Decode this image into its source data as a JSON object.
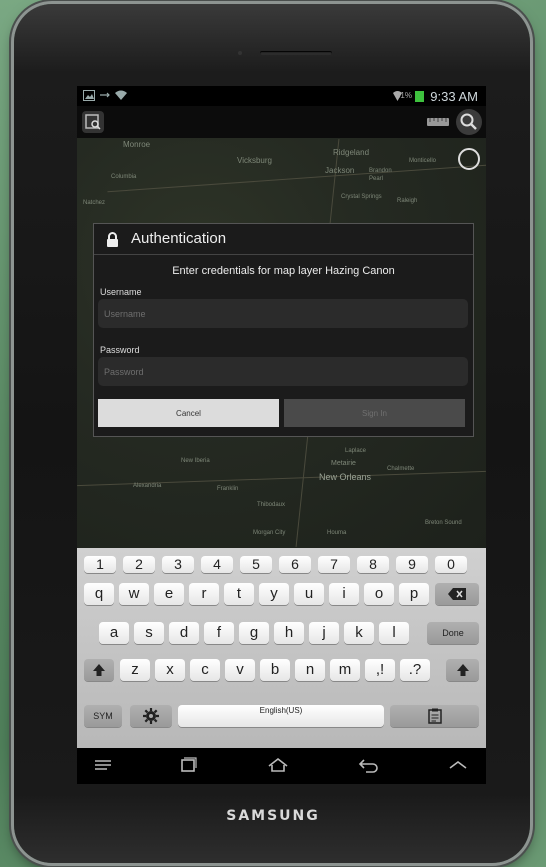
{
  "status_bar": {
    "battery_percent": "81%",
    "time": "9:33 AM"
  },
  "map": {
    "places": [
      "Monroe",
      "Vicksburg",
      "Ridgeland",
      "Jackson",
      "Pearl",
      "Columbia",
      "Brandon",
      "Crystal Springs",
      "Raleigh",
      "Natchez",
      "Monticello",
      "Alexandria",
      "New Iberia",
      "Laplace",
      "Metairie",
      "New Orleans",
      "Chalmette",
      "Houma",
      "Thibodaux",
      "Morgan City",
      "Breton Sound",
      "Franklin"
    ]
  },
  "dialog": {
    "title": "Authentication",
    "message": "Enter credentials for map layer Hazing Canon",
    "username_label": "Username",
    "username_placeholder": "Username",
    "password_label": "Password",
    "password_placeholder": "Password",
    "cancel_label": "Cancel",
    "sign_in_label": "Sign In"
  },
  "keyboard": {
    "numbers": [
      "1",
      "2",
      "3",
      "4",
      "5",
      "6",
      "7",
      "8",
      "9",
      "0"
    ],
    "row1": [
      "q",
      "w",
      "e",
      "r",
      "t",
      "y",
      "u",
      "i",
      "o",
      "p"
    ],
    "row2": [
      "a",
      "s",
      "d",
      "f",
      "g",
      "h",
      "j",
      "k",
      "l"
    ],
    "row3": [
      "z",
      "x",
      "c",
      "v",
      "b",
      "n",
      "m"
    ],
    "done": "Done",
    "sym": "SYM",
    "space_label": "English(US)",
    "comma": ",!",
    "period": ".?"
  },
  "device": {
    "brand": "SAMSUNG"
  },
  "colors": {
    "battery": "#3ec13e",
    "background": "#5e8f68"
  }
}
